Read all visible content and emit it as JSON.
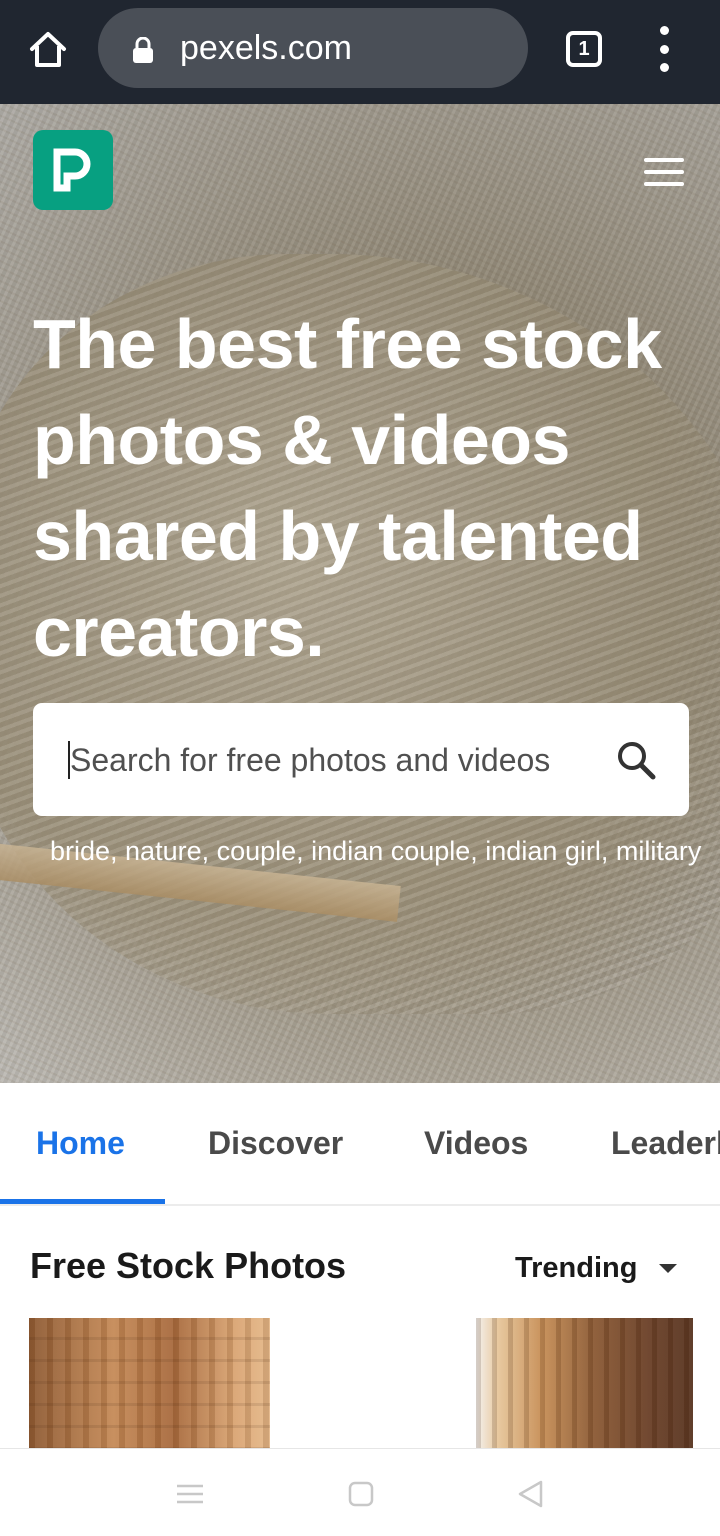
{
  "browser": {
    "url": "pexels.com",
    "tab_count": "1",
    "icons": {
      "home": "home-icon",
      "lock": "lock-icon",
      "tabs": "tab-switcher-icon",
      "menu": "more-vert-icon"
    }
  },
  "site": {
    "logo_letter": "P",
    "brand_color": "#07a081",
    "menu_icon": "hamburger-icon"
  },
  "hero": {
    "headline": "The best free stock photos & videos shared by talented creators.",
    "search": {
      "placeholder": "Search for free photos and videos",
      "icon": "search-icon"
    },
    "suggestions": "bride, nature, couple, indian couple, indian girl, military"
  },
  "nav": {
    "accent_color": "#1a73e8",
    "tabs": [
      {
        "label": "Home",
        "active": true
      },
      {
        "label": "Discover",
        "active": false
      },
      {
        "label": "Videos",
        "active": false
      },
      {
        "label": "Leaderboard",
        "active": false
      }
    ]
  },
  "section": {
    "title": "Free Stock Photos",
    "sort": {
      "selected": "Trending",
      "icon": "chevron-down-icon"
    }
  },
  "system_nav": {
    "icons": [
      "recent-apps-icon",
      "home-square-icon",
      "back-triangle-icon"
    ]
  }
}
